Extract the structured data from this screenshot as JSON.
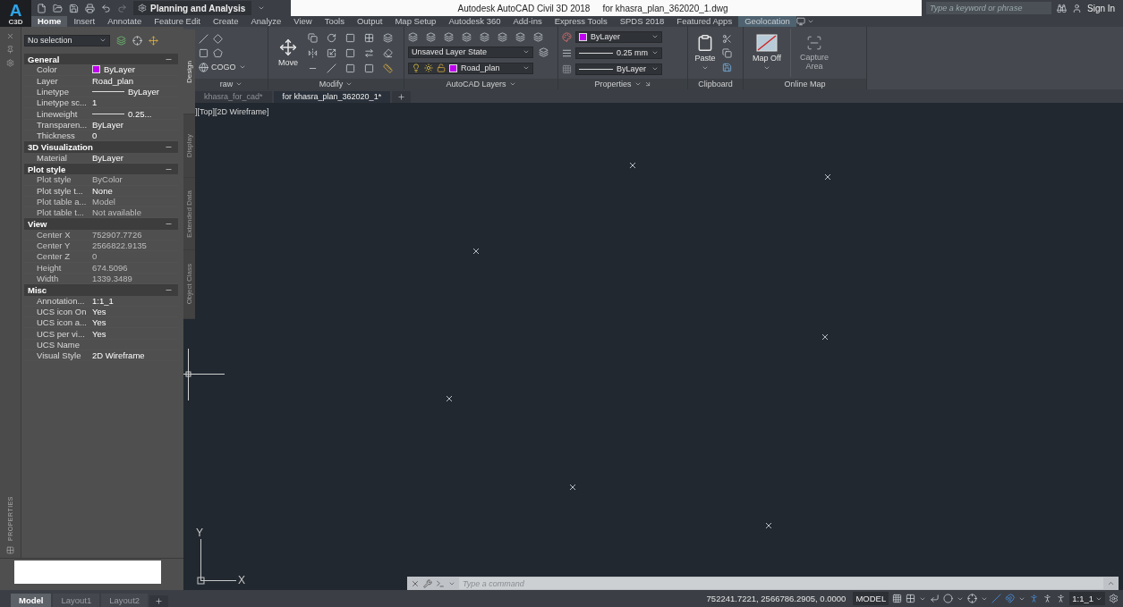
{
  "app_button": {
    "letter": "A",
    "label": "C3D"
  },
  "quick_access": {
    "workspace": "Planning and Analysis"
  },
  "title": {
    "app": "Autodesk AutoCAD Civil 3D 2018",
    "document": "for khasra_plan_362020_1.dwg"
  },
  "search": {
    "placeholder": "Type a keyword or phrase"
  },
  "account": {
    "label": "Sign In"
  },
  "ribbon_tabs": [
    {
      "label": "Home",
      "selected": true,
      "contextual": false
    },
    {
      "label": "Insert",
      "selected": false,
      "contextual": false
    },
    {
      "label": "Annotate",
      "selected": false,
      "contextual": false
    },
    {
      "label": "Feature Edit",
      "selected": false,
      "contextual": false
    },
    {
      "label": "Create",
      "selected": false,
      "contextual": false
    },
    {
      "label": "Analyze",
      "selected": false,
      "contextual": false
    },
    {
      "label": "View",
      "selected": false,
      "contextual": false
    },
    {
      "label": "Tools",
      "selected": false,
      "contextual": false
    },
    {
      "label": "Output",
      "selected": false,
      "contextual": false
    },
    {
      "label": "Map Setup",
      "selected": false,
      "contextual": false
    },
    {
      "label": "Autodesk 360",
      "selected": false,
      "contextual": false
    },
    {
      "label": "Add-ins",
      "selected": false,
      "contextual": false
    },
    {
      "label": "Express Tools",
      "selected": false,
      "contextual": false
    },
    {
      "label": "SPDS 2018",
      "selected": false,
      "contextual": false
    },
    {
      "label": "Featured Apps",
      "selected": false,
      "contextual": false
    },
    {
      "label": "Geolocation",
      "selected": false,
      "contextual": true
    }
  ],
  "ribbon": {
    "draw": {
      "title": "raw",
      "cogo": "COGO"
    },
    "modify": {
      "title": "Modify",
      "move": "Move"
    },
    "layers": {
      "title": "AutoCAD Layers",
      "layer_state": "Unsaved Layer State",
      "current_layer": "Road_plan"
    },
    "properties": {
      "title": "Properties",
      "color_setting": "ByLayer",
      "lineweight": "0.25 mm",
      "linetype": "ByLayer"
    },
    "clipboard": {
      "title": "Clipboard",
      "paste": "Paste"
    },
    "online_map": {
      "title": "Online Map",
      "map_off": "Map Off",
      "capture_area": "Capture Area",
      "capture_disabled": true
    }
  },
  "document_tabs": [
    {
      "label": "khasra_for_cad*",
      "selected": false
    },
    {
      "label": "for khasra_plan_362020_1*",
      "selected": true
    }
  ],
  "viewport_label": "][Top][2D Wireframe]",
  "properties_palette": {
    "title": "PROPERTIES",
    "selection": "No selection",
    "sections": [
      {
        "title": "General",
        "expanded": true,
        "rows": [
          {
            "label": "Color",
            "value": "ByLayer",
            "kind": "color",
            "disabled": false
          },
          {
            "label": "Layer",
            "value": "Road_plan",
            "kind": "text",
            "disabled": false
          },
          {
            "label": "Linetype",
            "value": "ByLayer",
            "kind": "line",
            "disabled": false
          },
          {
            "label": "Linetype sc...",
            "value": "1",
            "kind": "text",
            "disabled": false
          },
          {
            "label": "Lineweight",
            "value": "0.25...",
            "kind": "line",
            "disabled": false
          },
          {
            "label": "Transparen...",
            "value": "ByLayer",
            "kind": "text",
            "disabled": false
          },
          {
            "label": "Thickness",
            "value": "0",
            "kind": "text",
            "disabled": false
          }
        ]
      },
      {
        "title": "3D Visualization",
        "expanded": true,
        "rows": [
          {
            "label": "Material",
            "value": "ByLayer",
            "kind": "text",
            "disabled": false
          }
        ]
      },
      {
        "title": "Plot style",
        "expanded": true,
        "rows": [
          {
            "label": "Plot style",
            "value": "ByColor",
            "kind": "text",
            "disabled": true
          },
          {
            "label": "Plot style t...",
            "value": "None",
            "kind": "text",
            "disabled": false
          },
          {
            "label": "Plot table a...",
            "value": "Model",
            "kind": "text",
            "disabled": true
          },
          {
            "label": "Plot table t...",
            "value": "Not available",
            "kind": "text",
            "disabled": true
          }
        ]
      },
      {
        "title": "View",
        "expanded": true,
        "rows": [
          {
            "label": "Center X",
            "value": "752907.7726",
            "kind": "text",
            "disabled": true
          },
          {
            "label": "Center Y",
            "value": "2566822.9135",
            "kind": "text",
            "disabled": true
          },
          {
            "label": "Center Z",
            "value": "0",
            "kind": "text",
            "disabled": true
          },
          {
            "label": "Height",
            "value": "674.5096",
            "kind": "text",
            "disabled": true
          },
          {
            "label": "Width",
            "value": "1339.3489",
            "kind": "text",
            "disabled": true
          }
        ]
      },
      {
        "title": "Misc",
        "expanded": true,
        "rows": [
          {
            "label": "Annotation...",
            "value": "1:1_1",
            "kind": "text",
            "disabled": false
          },
          {
            "label": "UCS icon On",
            "value": "Yes",
            "kind": "text",
            "disabled": false
          },
          {
            "label": "UCS icon a...",
            "value": "Yes",
            "kind": "text",
            "disabled": false
          },
          {
            "label": "UCS per vi...",
            "value": "Yes",
            "kind": "text",
            "disabled": false
          },
          {
            "label": "UCS Name",
            "kind": "text",
            "disabled": false
          },
          {
            "label": "Visual Style",
            "value": "2D Wireframe",
            "kind": "text",
            "disabled": false
          }
        ]
      }
    ],
    "side_tabs": [
      {
        "label": "Design",
        "selected": true
      },
      {
        "label": "Display",
        "selected": false
      },
      {
        "label": "Extended Data",
        "selected": false
      },
      {
        "label": "Object Class",
        "selected": false
      }
    ]
  },
  "ucs_icon": {
    "x_label": "X",
    "y_label": "Y"
  },
  "command_line": {
    "placeholder": "Type a command"
  },
  "layout_tabs": [
    {
      "label": "Model",
      "selected": true
    },
    {
      "label": "Layout1",
      "selected": false
    },
    {
      "label": "Layout2",
      "selected": false
    }
  ],
  "status_bar": {
    "coordinates": "752241.7221, 2566786.2905, 0.0000",
    "space": "MODEL",
    "annotation_scale": "1:1_1"
  }
}
